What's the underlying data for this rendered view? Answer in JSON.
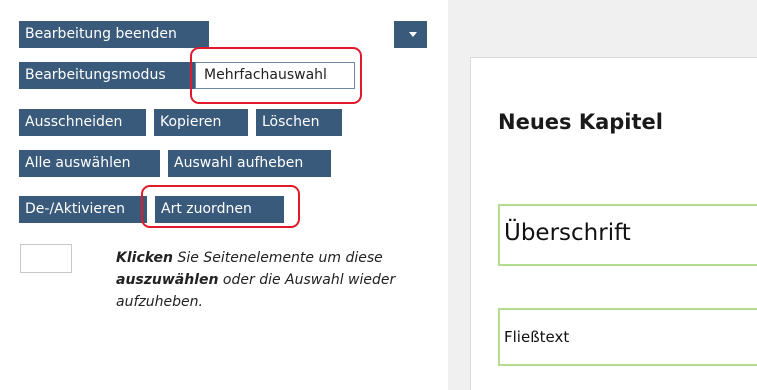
{
  "toolbar": {
    "finish_editing": "Bearbeitung beenden",
    "edit_mode": "Bearbeitungsmodus",
    "multi_select": "Mehrfachauswahl",
    "cut": "Ausschneiden",
    "copy": "Kopieren",
    "delete": "Löschen",
    "select_all": "Alle auswählen",
    "deselect": "Auswahl aufheben",
    "toggle_active": "De-/Aktivieren",
    "assign_type": "Art zuordnen",
    "menu_icon": "chevron-down-icon"
  },
  "hint": {
    "word_click": "Klicken",
    "part1": " Sie Seitenelemente um diese ",
    "word_select": "auszuwählen",
    "part2": " oder die Auswahl wieder aufzuheben."
  },
  "page": {
    "chapter_title": "Neues Kapitel",
    "heading_element": "Überschrift",
    "text_element": "Fließtext"
  },
  "colors": {
    "button_bg": "#3a5a7c",
    "highlight": "#e0192b",
    "element_border": "#b5dd92"
  }
}
